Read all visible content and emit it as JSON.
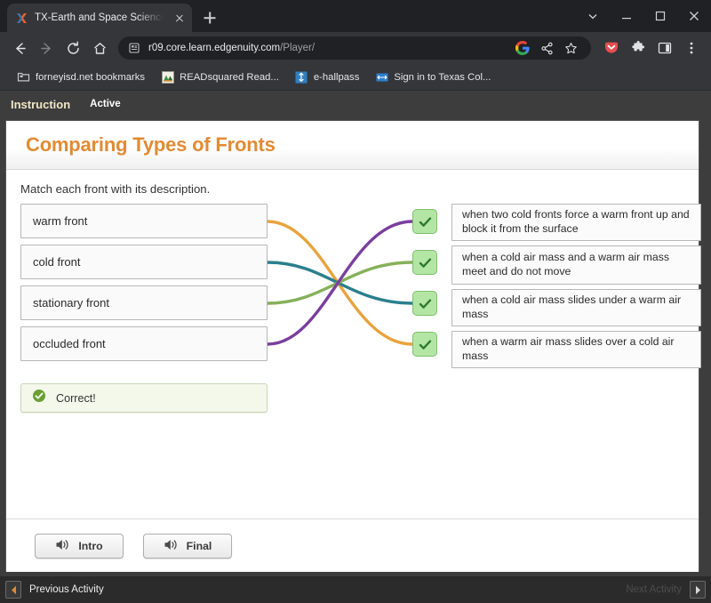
{
  "browser": {
    "tab": {
      "title": "TX-Earth and Space Science B - I",
      "favicon_name": "edgenuity-x-favicon",
      "close_label": "Close tab"
    },
    "new_tab_label": "New Tab",
    "window_controls": [
      "tab-search-chevron",
      "minimize",
      "maximize",
      "close"
    ],
    "nav": {
      "back_label": "Back",
      "forward_label": "Forward",
      "reload_label": "Reload",
      "home_label": "Home"
    },
    "omnibox": {
      "host": "r09.core.learn.edgenuity.com",
      "path": "/Player/",
      "site_icon": "document-page-icon",
      "actions": [
        "google-lens-icon",
        "share-icon",
        "bookmark-star-icon"
      ]
    },
    "toolbar_icons": [
      "pocket-extension-icon",
      "extensions-puzzle-icon",
      "side-panel-icon",
      "chrome-menu-icon"
    ],
    "bookmarks": [
      {
        "label": "forneyisd.net bookmarks",
        "icon": "folder-icon"
      },
      {
        "label": "READsquared Read...",
        "icon": "readsquared-icon"
      },
      {
        "label": "e-hallpass",
        "icon": "ehallpass-icon"
      },
      {
        "label": "Sign in to Texas Col...",
        "icon": "texas-college-icon"
      }
    ]
  },
  "app": {
    "topbar": {
      "instruction_label": "Instruction",
      "active_label": "Active"
    },
    "title": "Comparing Types of Fronts",
    "prompt": "Match each front with its description.",
    "fronts": [
      {
        "label": "warm front"
      },
      {
        "label": "cold front"
      },
      {
        "label": "stationary front"
      },
      {
        "label": "occluded front"
      }
    ],
    "descriptions": [
      {
        "text": "when two cold fronts force a warm front up and block it from the surface",
        "status": "correct"
      },
      {
        "text": "when a cold air mass and a warm air mass meet and do not move",
        "status": "correct"
      },
      {
        "text": "when a cold air mass slides under a warm air mass",
        "status": "correct"
      },
      {
        "text": "when a warm air mass slides over a cold air mass",
        "status": "correct"
      }
    ],
    "connections": [
      {
        "from": "warm front",
        "to": "when a warm air mass slides over a cold air mass",
        "color": "#e8a33d"
      },
      {
        "from": "cold front",
        "to": "when a cold air mass slides under a warm air mass",
        "color": "#2a7f8c"
      },
      {
        "from": "stationary front",
        "to": "when a cold air mass and a warm air mass meet and do not move",
        "color": "#86b05a"
      },
      {
        "from": "occluded front",
        "to": "when two cold fronts force a warm front up and block it from the surface",
        "color": "#7b3f9d"
      }
    ],
    "feedback": {
      "text": "Correct!",
      "icon": "check-circle-icon",
      "color": "#6aa033"
    },
    "audio_buttons": [
      {
        "label": "Intro",
        "icon": "speaker-icon"
      },
      {
        "label": "Final",
        "icon": "speaker-icon"
      }
    ],
    "bottom_nav": {
      "previous_label": "Previous Activity",
      "next_label": "Next Activity",
      "prev_icon": "triangle-left-icon",
      "next_icon": "triangle-right-icon"
    }
  },
  "colors": {
    "accent_title": "#e18b33",
    "check_badge_bg": "#b3e6a5",
    "check_badge_border": "#7dbf6c",
    "feedback_bg": "#f3f8ea"
  }
}
